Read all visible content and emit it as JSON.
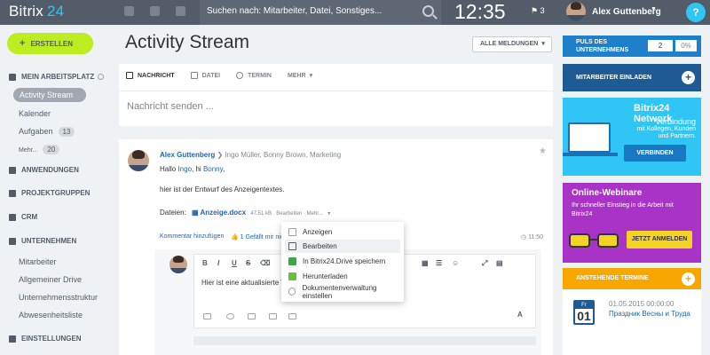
{
  "topbar": {
    "logo": "Bitrix",
    "logo_num": "24",
    "search_placeholder": "Suchen nach: Mitarbeiter, Datei, Sonstiges...",
    "clock": "12:35",
    "flag_count": "3",
    "user_name": "Alex Guttenberg",
    "help": "?"
  },
  "sidebar": {
    "create_label": "ERSTELLEN",
    "mein_arbeitsplatz": "MEIN ARBEITSPLATZ",
    "activity_stream": "Activity Stream",
    "kalender": "Kalender",
    "aufgaben": "Aufgaben",
    "aufgaben_count": "13",
    "mehr": "Mehr...",
    "mehr_count": "20",
    "anwendungen": "ANWENDUNGEN",
    "projektgruppen": "PROJEKTGRUPPEN",
    "crm": "CRM",
    "unternehmen": "UNTERNEHMEN",
    "mitarbeiter": "Mitarbeiter",
    "allgemeiner_drive": "Allgemeiner Drive",
    "unternehmensstruktur": "Unternehmensstruktur",
    "abwesenheitsliste": "Abwesenheitsliste",
    "einstellungen": "EINSTELLUNGEN"
  },
  "main": {
    "title": "Activity Stream",
    "filter_label": "ALLE MELDUNGEN",
    "tabs": [
      {
        "label": "NACHRICHT"
      },
      {
        "label": "DATEI"
      },
      {
        "label": "TERMIN"
      },
      {
        "label": "MEHR"
      }
    ],
    "message_placeholder": "Nachricht senden ..."
  },
  "post": {
    "author": "Alex Guttenberg",
    "recipients": "Ingo Müller, Bonny Brown, Marketing",
    "greeting_prefix": "Hallo ",
    "greeting_name1": "Ingo",
    "greeting_mid": ", hi ",
    "greeting_name2": "Bonny",
    "greeting_suffix": ",",
    "body": "hier ist der Entwurf des Anzeigentextes.",
    "files_label": "Dateien:",
    "file_name": "Anzeige.docx",
    "file_size": "47.51 kB",
    "file_actions": "Bearbeiten · Mehr...",
    "add_comment": "Kommentar hinzufügen",
    "like": "1 Gefällt mir nic",
    "time": "11:50"
  },
  "comment": {
    "editor_text": "Hier ist eine aktualisierte Ve"
  },
  "file_menu": {
    "items": [
      {
        "label": "Anzeigen"
      },
      {
        "label": "Bearbeiten"
      },
      {
        "label": "In Bitrix24.Drive speichern"
      },
      {
        "label": "Herunterladen"
      },
      {
        "label": "Dokumentenverwaltung einstellen"
      }
    ]
  },
  "right": {
    "pulse_label": "PULS DES UNTERNEHMENS",
    "pulse_value": "2",
    "pulse_percent": "0%",
    "invite_label": "MITARBEITER EINLADEN",
    "network_title": "Bitrix24 Network",
    "network_big": "Verbindung",
    "network_sub": "mit Kollegen, Kunden und Partnern.",
    "network_button": "VERBINDEN",
    "webinar_title": "Online-Webinare",
    "webinar_text": "Ihr schneller Einstieg in die Arbeit mit Bitrix24",
    "webinar_button": "JETZT ANMELDEN",
    "events_label": "ANSTEHENDE TERMINE",
    "event_day": "Fr",
    "event_num": "01",
    "event_date": "01.05.2015 00:00:00",
    "event_title": "Праздник Весны и Труда"
  },
  "colors": {
    "topbar": "#535c69",
    "accent": "#2fc6f6",
    "create": "#bbed21",
    "webinar": "#a933c7",
    "events": "#f7a700"
  }
}
